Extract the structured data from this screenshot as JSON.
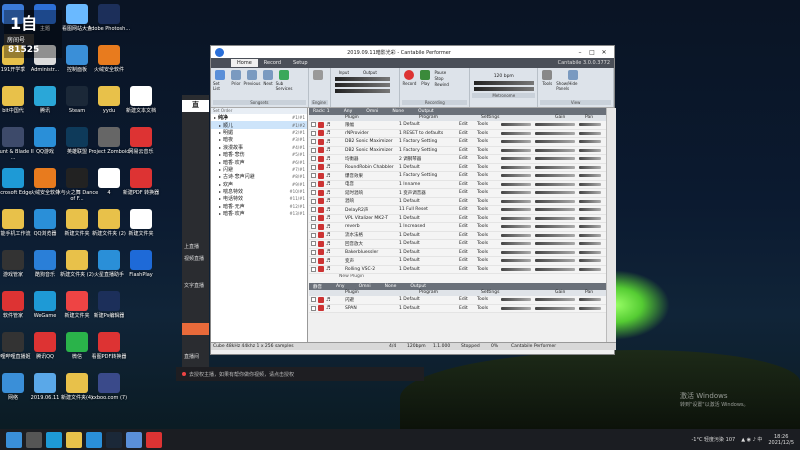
{
  "desktop": [
    {
      "label": "",
      "col": 0,
      "row": 0,
      "color": "#3b7ad8"
    },
    {
      "label": "主题",
      "col": 1,
      "row": 0,
      "color": "#2d6fd6"
    },
    {
      "label": "看图网站大全",
      "col": 2,
      "row": 0,
      "color": "#6ab9ff"
    },
    {
      "label": "Adobe Photosh...",
      "col": 3,
      "row": 0,
      "color": "#1c2f5a"
    },
    {
      "label": "191开学季",
      "col": 0,
      "row": 1,
      "color": "#e8c14a"
    },
    {
      "label": "Administr...",
      "col": 1,
      "row": 1,
      "color": "#ddd"
    },
    {
      "label": "控制面板",
      "col": 2,
      "row": 1,
      "color": "#3a8fd8"
    },
    {
      "label": "火绒安全软件",
      "col": 3,
      "row": 1,
      "color": "#e87b1e"
    },
    {
      "label": "bit中国代",
      "col": 0,
      "row": 2,
      "color": "#e8c14a"
    },
    {
      "label": "腾讯",
      "col": 1,
      "row": 2,
      "color": "#2aa7d8"
    },
    {
      "label": "Steam",
      "col": 2,
      "row": 2,
      "color": "#1b2838"
    },
    {
      "label": "yydu",
      "col": 3,
      "row": 2,
      "color": "#e8c14a"
    },
    {
      "label": "新建文本文档",
      "col": 4,
      "row": 2,
      "color": "#fff"
    },
    {
      "label": "Mount & Blade II ...",
      "col": 0,
      "row": 3,
      "color": "#3d4a6a"
    },
    {
      "label": "QQ游戏",
      "col": 1,
      "row": 3,
      "color": "#2a8fd8"
    },
    {
      "label": "英雄联盟",
      "col": 2,
      "row": 3,
      "color": "#0e3a5a"
    },
    {
      "label": "Project Zomboid",
      "col": 3,
      "row": 3,
      "color": "#666"
    },
    {
      "label": "网易云音乐",
      "col": 4,
      "row": 3,
      "color": "#d33"
    },
    {
      "label": "Microsoft Edge",
      "col": 0,
      "row": 4,
      "color": "#1e9ad6"
    },
    {
      "label": "火绒安全软件",
      "col": 1,
      "row": 4,
      "color": "#e87b1e"
    },
    {
      "label": "冰与火之舞 Dance of F...",
      "col": 2,
      "row": 4,
      "color": "#222"
    },
    {
      "label": "4",
      "col": 3,
      "row": 4,
      "color": "#fff"
    },
    {
      "label": "新建PDF 转换器",
      "col": 4,
      "row": 4,
      "color": "#d33"
    },
    {
      "label": "高能手机工作流",
      "col": 0,
      "row": 5,
      "color": "#e8c14a"
    },
    {
      "label": "QQ浏览器",
      "col": 1,
      "row": 5,
      "color": "#2a8fd8"
    },
    {
      "label": "新建文件夹",
      "col": 2,
      "row": 5,
      "color": "#e8c14a"
    },
    {
      "label": "新建文件夹 (2)",
      "col": 3,
      "row": 5,
      "color": "#e8c14a"
    },
    {
      "label": "新建文件夹",
      "col": 4,
      "row": 5,
      "color": "#fff"
    },
    {
      "label": "游戏管家",
      "col": 0,
      "row": 6,
      "color": "#333"
    },
    {
      "label": "酷狗音乐",
      "col": 1,
      "row": 6,
      "color": "#2a7fd8"
    },
    {
      "label": "新建文件夹 (2)",
      "col": 2,
      "row": 6,
      "color": "#e8c14a"
    },
    {
      "label": "火星直播助手",
      "col": 3,
      "row": 6,
      "color": "#2a8fd8"
    },
    {
      "label": "FlashPlay",
      "col": 4,
      "row": 6,
      "color": "#1e6ad8"
    },
    {
      "label": "软件管家",
      "col": 0,
      "row": 7,
      "color": "#d33"
    },
    {
      "label": "WeGame",
      "col": 1,
      "row": 7,
      "color": "#1e9ad6"
    },
    {
      "label": "新建文件夹",
      "col": 2,
      "row": 7,
      "color": "#e44"
    },
    {
      "label": "新建Ps编辑器",
      "col": 3,
      "row": 7,
      "color": "#1c2f5a"
    },
    {
      "label": "哔哩哔哩直播姬",
      "col": 0,
      "row": 8,
      "color": "#333"
    },
    {
      "label": "腾讯QQ",
      "col": 1,
      "row": 8,
      "color": "#d33"
    },
    {
      "label": "微信",
      "col": 2,
      "row": 8,
      "color": "#2ab34a"
    },
    {
      "label": "看图PDF转换器",
      "col": 3,
      "row": 8,
      "color": "#d33"
    },
    {
      "label": "网络",
      "col": 0,
      "row": 9,
      "color": "#3a8fd8"
    },
    {
      "label": "2019.06.11",
      "col": 1,
      "row": 9,
      "color": "#5aa8e8"
    },
    {
      "label": "新建文件夹(4)",
      "col": 2,
      "row": 9,
      "color": "#e8c14a"
    },
    {
      "label": "xxboo.com (7)",
      "col": 3,
      "row": 9,
      "color": "#3a4a8a"
    }
  ],
  "overlay": {
    "room_label": "房间号",
    "room_num": "81525"
  },
  "bili": {
    "items": [
      "上直播",
      "视频直播",
      "文字直播",
      "直播间",
      "动态"
    ]
  },
  "notification": "去授权主播，如果有帮你做你视频，请点击授权",
  "window": {
    "title": "2019.09.11暗影光彩 - Cantabile Performer",
    "version": "Cantabile 3.0.0.3772",
    "tabs": [
      "Home",
      "Record",
      "Setup"
    ],
    "ribbon_groups": [
      "Songsets",
      "Engine",
      "Input",
      "Output",
      "Recording",
      "Metronome",
      "View"
    ],
    "ribbon_buttons": [
      "Set List",
      "Prior",
      "Previous",
      "Next",
      "Sub Services",
      "Record",
      "Play",
      "Pause",
      "Stop",
      "Rewind",
      "Tools",
      "Show/Hide Panels"
    ],
    "tempo": "120 bpm",
    "tree_header": "Set Order",
    "tree": [
      {
        "name": "纯净",
        "key": "#1/#1",
        "top": true
      },
      {
        "name": "顺儿",
        "key": "#1/#2",
        "sel": true
      },
      {
        "name": "明媚",
        "key": "#2/#1"
      },
      {
        "name": "暗夜",
        "key": "#3/#1"
      },
      {
        "name": "浪漫故事",
        "key": "#4/#1"
      },
      {
        "name": "暗香·悲伤",
        "key": "#5/#1"
      },
      {
        "name": "暗香·欢声",
        "key": "#6/#1"
      },
      {
        "name": "闪避",
        "key": "#7/#1"
      },
      {
        "name": "古诗·悲声闪避",
        "key": "#8/#1"
      },
      {
        "name": "欢声",
        "key": "#9/#1"
      },
      {
        "name": "喘息特效",
        "key": "#10/#1"
      },
      {
        "name": "电话特效",
        "key": "#11/#1"
      },
      {
        "name": "暗香·无声",
        "key": "#12/#1"
      },
      {
        "name": "暗香·欢声",
        "key": "#13/#1"
      }
    ],
    "rack_head": [
      "Rack: 1",
      "Any",
      "Omni",
      "None",
      "Output"
    ],
    "columns": [
      "Plugin",
      "Program",
      "Settings",
      "Gain",
      "Pan"
    ],
    "plugins": [
      {
        "name": "限幅",
        "prog": "1 Default"
      },
      {
        "name": "rNProvider",
        "prog": "1 RESET to defaults"
      },
      {
        "name": "DB2 Sonic Maximizer",
        "prog": "1 Factory Setting"
      },
      {
        "name": "DB2 Sonic Maximizer",
        "prog": "1 Factory Setting"
      },
      {
        "name": "均衡器",
        "prog": "2 调钢琴器"
      },
      {
        "name": "RoundRobin Chabbler",
        "prog": "1 Default"
      },
      {
        "name": "爆音效果",
        "prog": "1 Factory Setting"
      },
      {
        "name": "电音",
        "prog": "1 Inname"
      },
      {
        "name": "延时混响",
        "prog": "1 变声调音器"
      },
      {
        "name": "混响",
        "prog": "1 Default"
      },
      {
        "name": "DelayR2声",
        "prog": "11 Full Reset"
      },
      {
        "name": "VPL Vitalizer MK2-T",
        "prog": "1 Default"
      },
      {
        "name": "reverb",
        "prog": "1 Increased"
      },
      {
        "name": "流水法格",
        "prog": "1 Default"
      },
      {
        "name": "回音放大",
        "prog": "1 Default"
      },
      {
        "name": "Bakerbluessler",
        "prog": "1 Default"
      },
      {
        "name": "变声",
        "prog": "1 Default"
      },
      {
        "name": "Rolling VSC-2",
        "prog": "1 Default"
      }
    ],
    "new_plugin": "New Plugin",
    "rack2_head": [
      "静音",
      "Any",
      "Omni",
      "None",
      "Output"
    ],
    "plugins2": [
      {
        "name": "闪避",
        "prog": "1 Default"
      },
      {
        "name": "SPAN",
        "prog": "1 Default"
      }
    ],
    "row_actions": {
      "edit": "Edit",
      "tools": "Tools"
    },
    "status_left": "Cube 48kHz 44khz 1 x 256 samples",
    "status": [
      "4/4",
      "120bpm",
      "1.1.000",
      "Stopped",
      "0%",
      "Cantabile Performer"
    ]
  },
  "taskbar": {
    "weather": "-1°C 轻度污染 107",
    "time": "18:26",
    "date": "2021/12/5"
  },
  "watermark": {
    "line1": "激活 Windows",
    "line2": "转到\"设置\"以激活 Windows。"
  }
}
